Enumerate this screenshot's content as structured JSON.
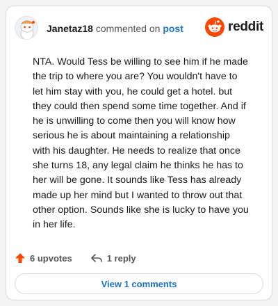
{
  "comment": {
    "username": "Janetaz18",
    "commented_on_text": "commented on",
    "post_link": "post",
    "brand": "reddit",
    "body": "NTA. Would Tess be willing to see him if he made the trip to where you are? You wouldn't have to let him stay with you, he could get a hotel. but they could then spend some time together. And if he is unwilling to come then you will know how serious he is about maintaining a relationship with his daughter. He needs to realize that once she turns 18, any legal claim he thinks he has to her will be gone. It sounds like Tess has already made up her mind but I wanted to throw out that other option. Sounds like she is lucky to have you in her life."
  },
  "actions": {
    "upvotes_label": "6 upvotes",
    "reply_label": "1 reply",
    "view_comments_label": "View 1 comments"
  },
  "colors": {
    "accent_orange": "#ff4500",
    "link_blue": "#1a73c8"
  },
  "icons": {
    "avatar": "snoo-avatar-icon",
    "brand": "reddit-logo-icon",
    "upvote": "upvote-arrow-icon",
    "reply": "reply-arrow-icon"
  }
}
